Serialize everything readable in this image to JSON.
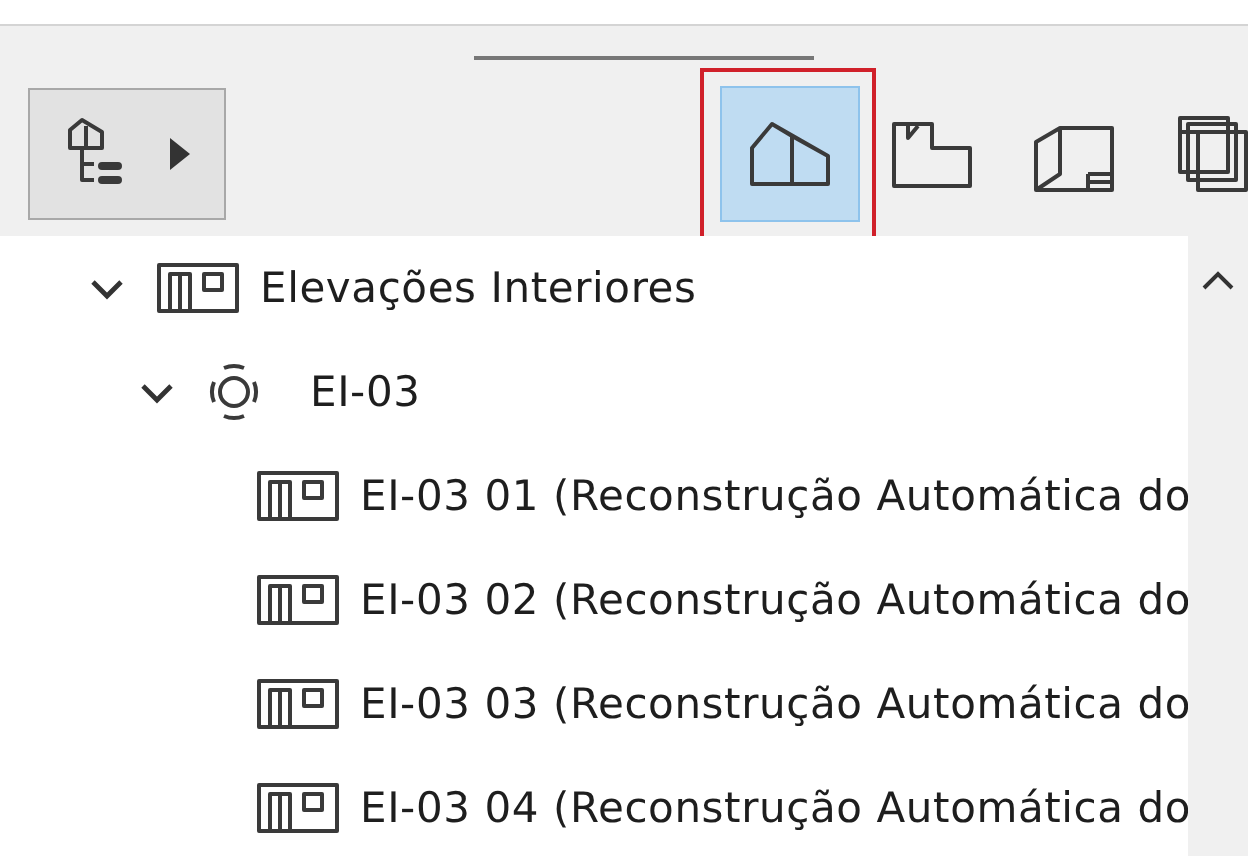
{
  "toolbar": {
    "view_buttons": [
      {
        "kind": "house",
        "selected": true,
        "highlighted": true
      },
      {
        "kind": "plan",
        "selected": false,
        "highlighted": false
      },
      {
        "kind": "sheet",
        "selected": false,
        "highlighted": false
      },
      {
        "kind": "stack",
        "selected": false,
        "highlighted": false
      }
    ]
  },
  "tree": [
    {
      "kind": "elevation",
      "label": "Elevações Interiores",
      "expanded": true,
      "children": [
        {
          "kind": "marker",
          "label": "EI-03",
          "expanded": true,
          "children": [
            {
              "kind": "elevation",
              "label": "EI-03 01 (Reconstrução Automática do"
            },
            {
              "kind": "elevation",
              "label": "EI-03 02 (Reconstrução Automática do"
            },
            {
              "kind": "elevation",
              "label": "EI-03 03 (Reconstrução Automática do"
            },
            {
              "kind": "elevation",
              "label": "EI-03 04 (Reconstrução Automática do"
            }
          ]
        }
      ]
    }
  ]
}
